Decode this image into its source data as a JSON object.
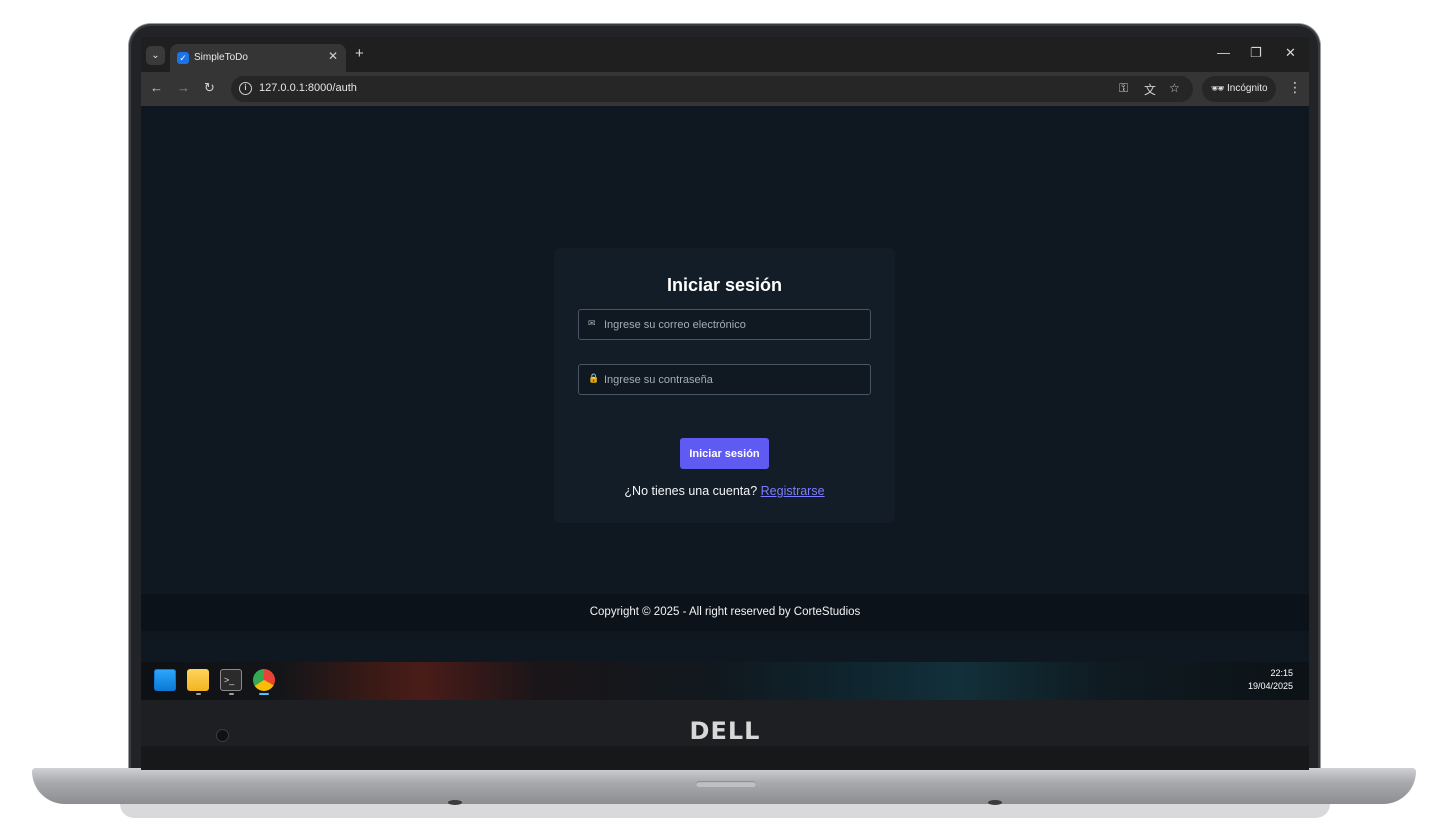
{
  "browser": {
    "tab_title": "SimpleToDo",
    "tab_close": "✕",
    "new_tab": "+",
    "url": "127.0.0.1:8000/auth",
    "profile_label": "Incógnito",
    "window_controls": {
      "minimize": "—",
      "restore": "❐",
      "close": "✕"
    }
  },
  "login": {
    "title": "Iniciar sesión",
    "email_placeholder": "Ingrese su correo electrónico",
    "password_placeholder": "Ingrese su contraseña",
    "submit_label": "Iniciar sesión",
    "register_prompt": "¿No tienes una cuenta?",
    "register_link": "Registrarse"
  },
  "footer": {
    "copyright": "Copyright © 2025 - All right reserved by CorteStudios"
  },
  "taskbar": {
    "icons": [
      "windows-start-icon",
      "file-explorer-icon",
      "terminal-icon",
      "chrome-icon"
    ],
    "time": "22:15",
    "date": "19/04/2025"
  },
  "device": {
    "brand": "DELL"
  },
  "colors": {
    "page_bg": "#0f1720",
    "card_bg": "#131d28",
    "button_bg": "#5f5bf2",
    "link": "#7c7cff"
  }
}
